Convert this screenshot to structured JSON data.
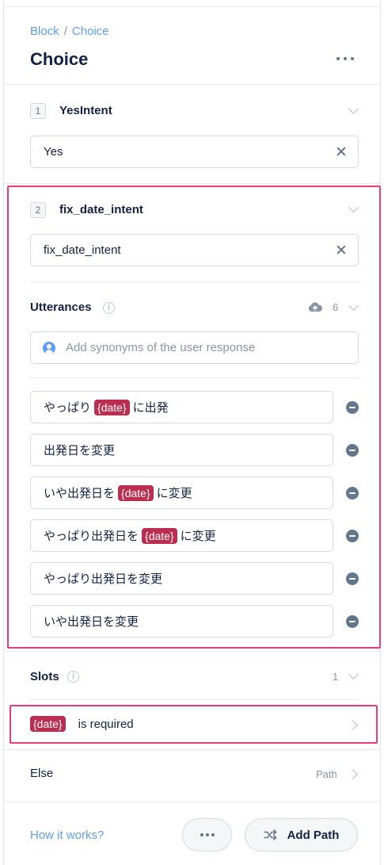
{
  "breadcrumb": {
    "parent": "Block",
    "separator": "/",
    "current": "Choice"
  },
  "title": "Choice",
  "intents": [
    {
      "number": "1",
      "name": "YesIntent",
      "value": "Yes"
    },
    {
      "number": "2",
      "name": "fix_date_intent",
      "value": "fix_date_intent"
    }
  ],
  "utterances": {
    "label": "Utterances",
    "count": "6",
    "placeholder": "Add synonyms of the user response",
    "items": [
      {
        "before": "やっぱり",
        "var": "{date}",
        "after": "に出発"
      },
      {
        "before": "出発日を変更",
        "var": "",
        "after": ""
      },
      {
        "before": "いや出発日を",
        "var": "{date}",
        "after": "に変更"
      },
      {
        "before": "やっぱり出発日を",
        "var": "{date}",
        "after": "に変更"
      },
      {
        "before": "やっぱり出発日を変更",
        "var": "",
        "after": ""
      },
      {
        "before": "いや出発日を変更",
        "var": "",
        "after": ""
      }
    ]
  },
  "slots": {
    "label": "Slots",
    "count": "1",
    "item": {
      "var": "{date}",
      "text": "is required"
    }
  },
  "else": {
    "label": "Else",
    "path": "Path"
  },
  "footer": {
    "help_link": "How it works?",
    "add_path": "Add Path"
  },
  "colors": {
    "accent": "#5d9df5",
    "highlight": "#ec3b78",
    "variable_chip": "#bd2d4f"
  },
  "icons": [
    "more-horizontal-icon",
    "chevron-down-icon",
    "close-icon",
    "info-icon",
    "upload-cloud-icon",
    "user-icon",
    "minus-circle-icon",
    "chevron-right-icon",
    "shuffle-icon"
  ]
}
